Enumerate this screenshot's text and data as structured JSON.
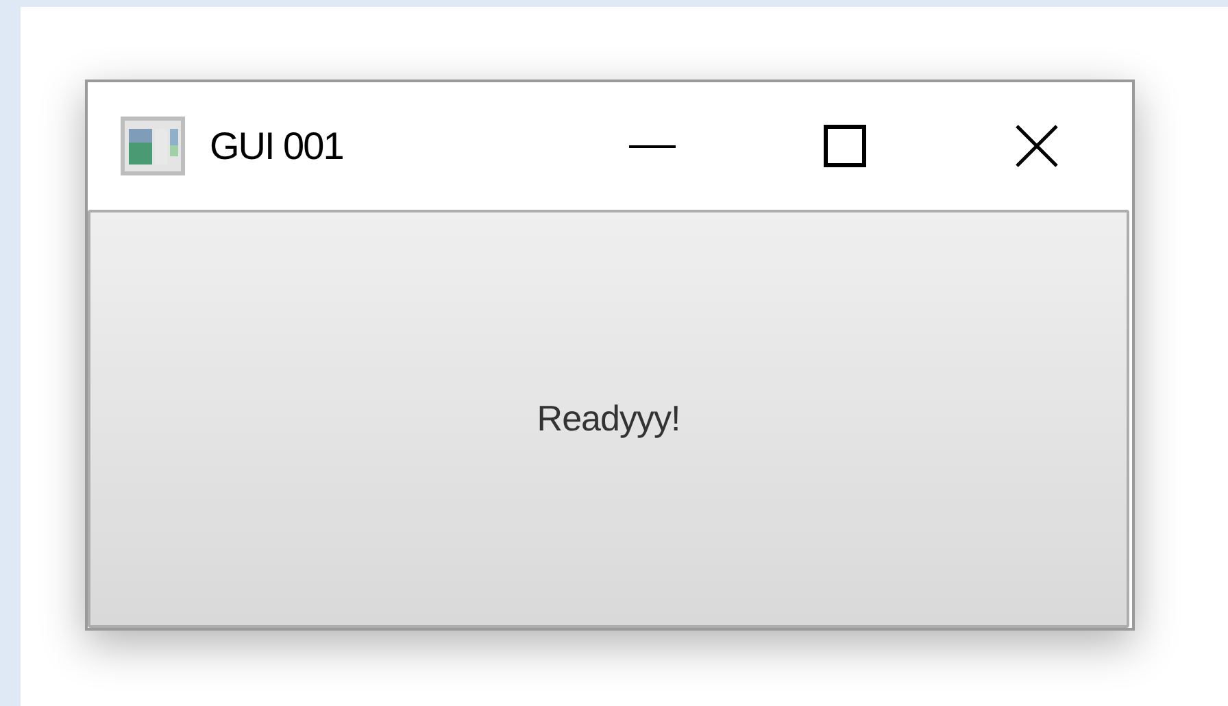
{
  "window": {
    "title": "GUI 001"
  },
  "button": {
    "label": "Readyyy!"
  }
}
